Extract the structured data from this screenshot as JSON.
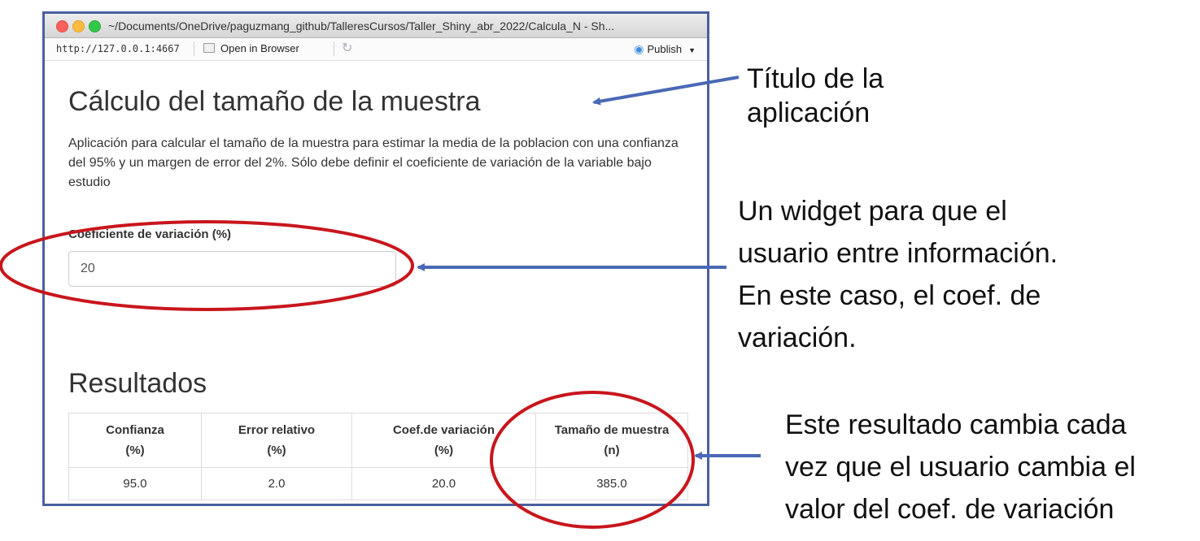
{
  "window": {
    "title": "~/Documents/OneDrive/paguzmang_github/TalleresCursos/Taller_Shiny_abr_2022/Calcula_N - Sh...",
    "url": "http://127.0.0.1:4667",
    "open_in_browser": "Open in Browser",
    "publish": "Publish"
  },
  "app": {
    "title": "Cálculo del tamaño de la muestra",
    "description": "Aplicación para calcular el tamaño de la muestra para estimar la media de la poblacion con una confianza del 95% y un margen de error del 2%. Sólo debe definir el coeficiente de variación de la variable bajo estudio",
    "input_label": "Coeficiente de variación (%)",
    "input_value": "20",
    "results_title": "Resultados",
    "table": {
      "headers": [
        [
          "Confianza",
          "(%)"
        ],
        [
          "Error relativo",
          "(%)"
        ],
        [
          "Coef.de variación",
          "(%)"
        ],
        [
          "Tamaño de muestra",
          "(n)"
        ]
      ],
      "row": [
        "95.0",
        "2.0",
        "20.0",
        "385.0"
      ]
    }
  },
  "annotations": {
    "title_note": [
      "Título de la",
      "aplicación"
    ],
    "widget_note": [
      "Un widget para que el",
      "usuario entre información.",
      "En este caso, el coef. de",
      "variación."
    ],
    "result_note": [
      "Este resultado cambia cada",
      "vez que el usuario cambia el",
      "valor del coef. de variación"
    ]
  },
  "colors": {
    "frame": "#4a5fa0",
    "arrow": "#4a68b5",
    "ellipse": "#c8161d"
  }
}
